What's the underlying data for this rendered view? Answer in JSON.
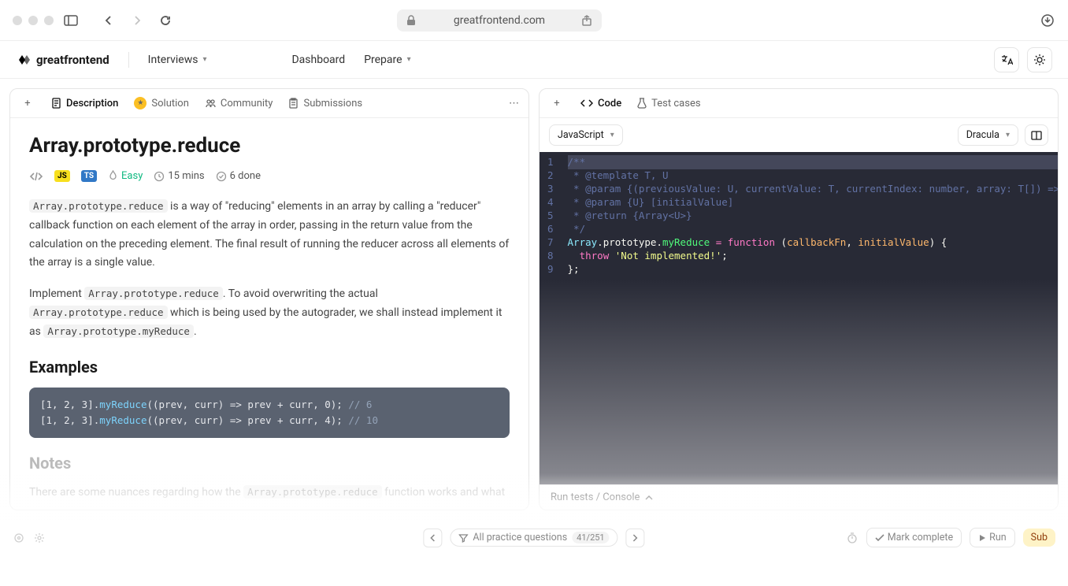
{
  "browser": {
    "url": "greatfrontend.com"
  },
  "header": {
    "logo": "greatfrontend",
    "nav": {
      "interviews": "Interviews",
      "dashboard": "Dashboard",
      "prepare": "Prepare"
    }
  },
  "left": {
    "tabs": {
      "description": "Description",
      "solution": "Solution",
      "community": "Community",
      "submissions": "Submissions"
    },
    "title": "Array.prototype.reduce",
    "meta": {
      "difficulty": "Easy",
      "time": "15 mins",
      "done": "6 done"
    },
    "p1_code": "Array.prototype.reduce",
    "p1_rest": " is a way of \"reducing\" elements in an array by calling a \"reducer\" callback function on each element of the array in order, passing in the return value from the calculation on the preceding element. The final result of running the reducer across all elements of the array is a single value.",
    "p2_a": "Implement ",
    "p2_code1": "Array.prototype.reduce",
    "p2_b": ". To avoid overwriting the actual ",
    "p2_code2": "Array.prototype.reduce",
    "p2_c": " which is being used by the autograder, we shall instead implement it as ",
    "p2_code3": "Array.prototype.myReduce",
    "p2_d": ".",
    "examples_h": "Examples",
    "example1_pre": "[1, 2, 3].",
    "example1_method": "myReduce",
    "example1_mid": "((prev, curr) => prev + curr, 0); ",
    "example1_comment": "// 6",
    "example2_pre": "[1, 2, 3].",
    "example2_method": "myReduce",
    "example2_mid": "((prev, curr) => prev + curr, 4); ",
    "example2_comment": "// 10",
    "notes_h": "Notes",
    "notes_p_a": "There are some nuances regarding how the ",
    "notes_code": "Array.prototype.reduce",
    "notes_p_b": " function works and what"
  },
  "right": {
    "tabs": {
      "code": "Code",
      "tests": "Test cases"
    },
    "language": "JavaScript",
    "theme": "Dracula",
    "lines": [
      "/**",
      " * @template T, U",
      " * @param {(previousValue: U, currentValue: T, currentIndex: number, array: T[]) => U",
      " * @param {U} [initialValue]",
      " * @return {Array<U>}",
      " */",
      "",
      "",
      ""
    ],
    "console": "Run tests / Console"
  },
  "bottom": {
    "filter": "All practice questions",
    "count": "41/251",
    "mark": "Mark complete",
    "run": "Run",
    "submit": "Sub"
  }
}
